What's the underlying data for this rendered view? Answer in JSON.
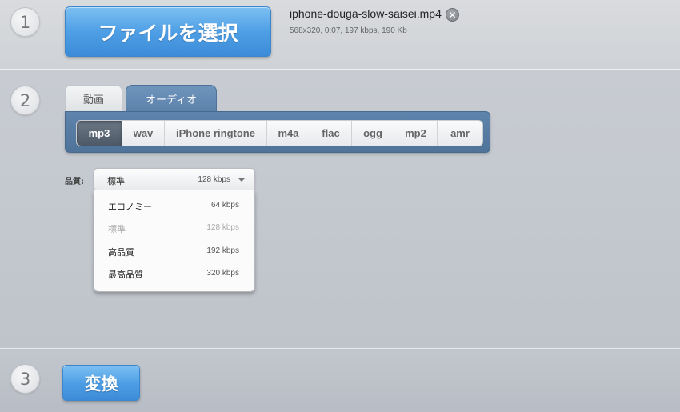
{
  "steps": {
    "one": "1",
    "two": "2",
    "three": "3"
  },
  "file": {
    "choose_label": "ファイルを選択",
    "name": "iphone-douga-slow-saisei.mp4",
    "meta": "568x320, 0:07, 197 kbps, 190 Kb",
    "remove_icon": "close-circle-icon"
  },
  "tabs": [
    {
      "label": "動画",
      "active": false
    },
    {
      "label": "オーディオ",
      "active": true
    }
  ],
  "formats": [
    {
      "label": "mp3",
      "active": true
    },
    {
      "label": "wav"
    },
    {
      "label": "iPhone ringtone"
    },
    {
      "label": "m4a"
    },
    {
      "label": "flac"
    },
    {
      "label": "ogg"
    },
    {
      "label": "mp2"
    },
    {
      "label": "amr"
    }
  ],
  "quality": {
    "label": "品質:",
    "selected_label": "標準",
    "selected_rate": "128 kbps",
    "options": [
      {
        "label": "エコノミー",
        "rate": "64 kbps",
        "disabled": false
      },
      {
        "label": "標準",
        "rate": "128 kbps",
        "disabled": true
      },
      {
        "label": "高品質",
        "rate": "192 kbps",
        "disabled": false
      },
      {
        "label": "最高品質",
        "rate": "320 kbps",
        "disabled": false
      }
    ]
  },
  "convert": {
    "label": "変換"
  },
  "colors": {
    "accent_blue": "#4f9fe6",
    "panel_blue": "#5e84ad",
    "active_format": "#5a6673"
  }
}
